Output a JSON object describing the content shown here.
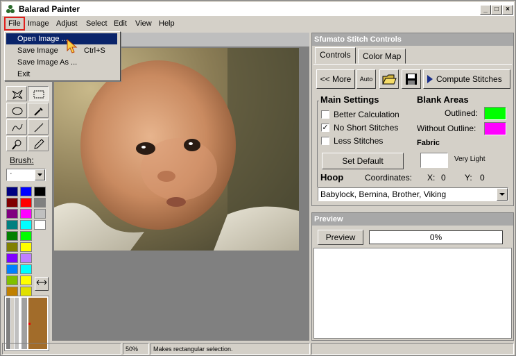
{
  "window": {
    "title": "Balarad Painter",
    "controls": [
      "_",
      "□",
      "×"
    ]
  },
  "menubar": [
    "File",
    "Image",
    "Adjust",
    "Select",
    "Edit",
    "View",
    "Help"
  ],
  "file_menu": {
    "items": [
      {
        "label": "Open Image ...",
        "shortcut": ""
      },
      {
        "label": "Save Image",
        "shortcut": "Ctrl+S"
      },
      {
        "label": "Save Image As ...",
        "shortcut": ""
      },
      {
        "label": "Exit",
        "shortcut": ""
      }
    ]
  },
  "tools": {
    "items": [
      "lasso-icon",
      "rect-select-icon",
      "ellipse-icon",
      "eyedropper-icon",
      "curve-icon",
      "line-icon",
      "magnifier-icon",
      "pencil-icon"
    ],
    "brush_label": "Brush:",
    "brush_value": "·"
  },
  "palette": {
    "colors": [
      "#000080",
      "#0000ff",
      "#000000",
      "#800000",
      "#ff0000",
      "#808080",
      "#800080",
      "#ff00ff",
      "#c0c0c0",
      "#008080",
      "#00ffff",
      "#ffffff",
      "#008000",
      "#00ff00",
      "",
      "#808000",
      "#ffff00",
      "",
      "#8000ff",
      "#c080ff",
      "",
      "#0080ff",
      "#00ffff",
      "",
      "#80c000",
      "#ffff00",
      "",
      "#c08000",
      "#e0e000",
      ""
    ],
    "swap_icon": "swap-arrows-icon"
  },
  "status": {
    "zoom": "50%",
    "message": "Makes rectangular selection."
  },
  "controls_panel": {
    "title": "Sfumato Stitch Controls",
    "tabs": [
      "Controls",
      "Color Map"
    ],
    "buttons": {
      "more": "<< More",
      "auto": "Auto",
      "compute": "Compute Stitches"
    },
    "main_settings": {
      "heading": "Main Settings",
      "options": [
        {
          "label": "Better Calculation",
          "checked": false
        },
        {
          "label": "No Short Stitches",
          "checked": true
        },
        {
          "label": "Less Stitches",
          "checked": false
        }
      ],
      "set_default": "Set Default"
    },
    "blank_areas": {
      "heading": "Blank Areas",
      "outlined_label": "Outlined:",
      "outlined_color": "#00ff00",
      "without_outline_label": "Without Outline:",
      "without_outline_color": "#ff00ff"
    },
    "fabric": {
      "heading": "Fabric",
      "color": "#ffffff",
      "value": "Very Light"
    },
    "hoop": {
      "heading": "Hoop",
      "coords_label": "Coordinates:",
      "x_label": "X:",
      "x": "0",
      "y_label": "Y:",
      "y": "0",
      "machine": "Babylock, Bernina, Brother, Viking"
    }
  },
  "preview_panel": {
    "title": "Preview",
    "button": "Preview",
    "progress_text": "0%",
    "progress": 0
  }
}
